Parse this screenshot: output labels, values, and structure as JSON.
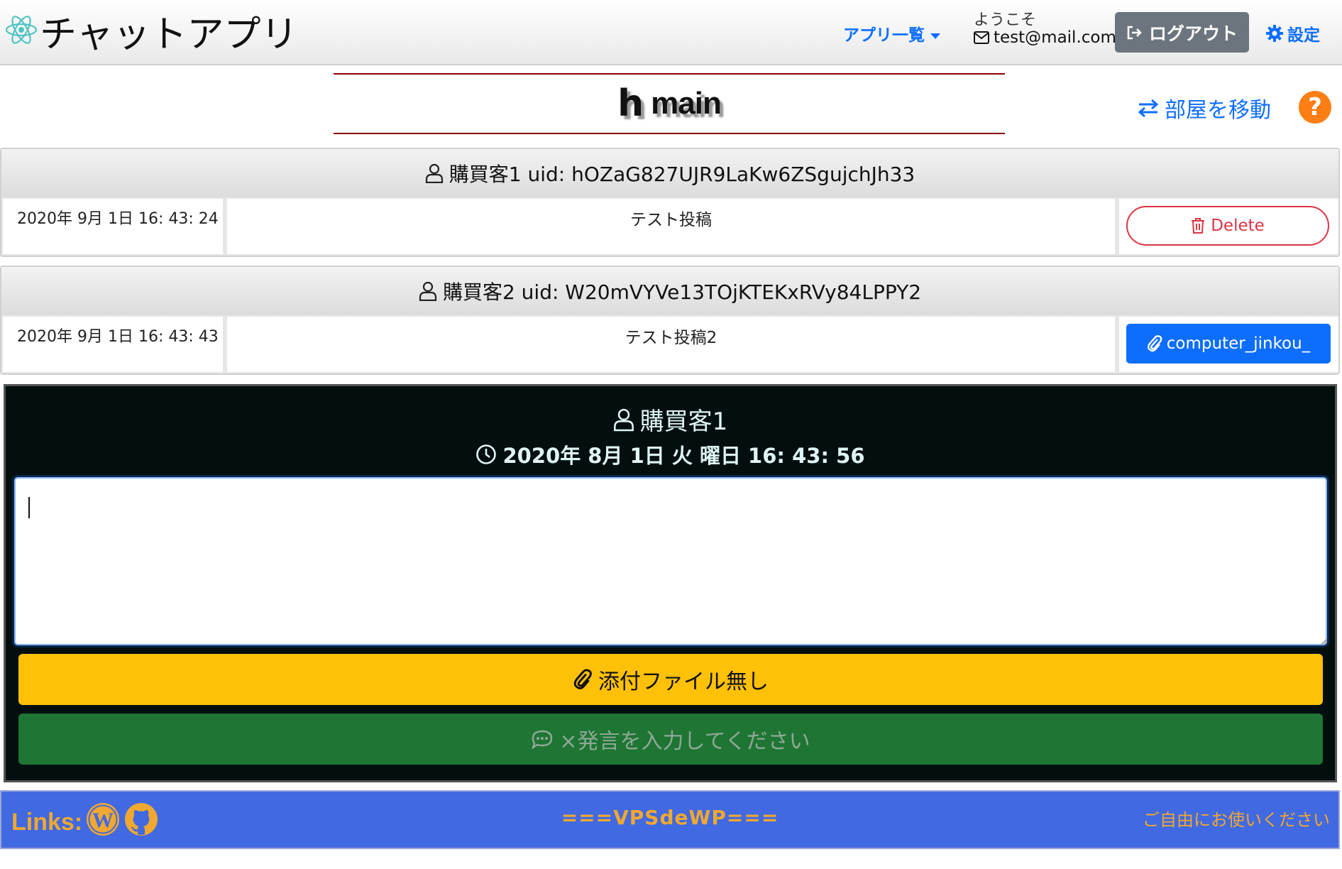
{
  "header": {
    "brand": "チャットアプリ",
    "apps_menu": "アプリ一覧",
    "welcome": "ようこそ",
    "email": "test@mail.com",
    "logout": "ログアウト",
    "settings": "設定"
  },
  "room": {
    "icon_letter": "h",
    "name": "main",
    "move_room": "部屋を移動",
    "help": "?"
  },
  "messages": [
    {
      "header": "購買客1 uid: hOZaG827UJR9LaKw6ZSgujchJh33",
      "time": "2020年 9月 1日 16: 43: 24",
      "text": "テスト投稿",
      "action_label": "Delete",
      "action_type": "delete"
    },
    {
      "header": "購買客2 uid: W20mVYVe13TOjKTEKxRVy84LPPY2",
      "time": "2020年 9月 1日 16: 43: 43",
      "text": "テスト投稿2",
      "action_label": "computer_jinkou_",
      "action_type": "attachment"
    }
  ],
  "compose": {
    "user": "購買客1",
    "datetime": "2020年 8月 1日 火 曜日 16: 43: 56",
    "textarea_value": "",
    "attach_label": "添付ファイル無し",
    "send_label": "×発言を入力してください"
  },
  "footer": {
    "links_label": "Links:",
    "center": "===VPSdeWP===",
    "right": "ご自由にお使いください"
  },
  "colors": {
    "primary": "#0d6efd",
    "danger": "#dc3545",
    "warning": "#ffc107",
    "success": "#1e7534",
    "secondary": "#6c757d",
    "footer_bg": "#4169e1",
    "footer_text": "#f0a830",
    "compose_bg": "#030f0f"
  },
  "icons": {
    "brand": "react-atom-icon",
    "email": "envelope-icon",
    "logout": "sign-out-icon",
    "settings": "gear-icon",
    "move_room": "exchange-arrows-icon",
    "help": "question-circle-icon",
    "user": "user-icon",
    "delete": "trash-icon",
    "attachment": "paperclip-icon",
    "clock": "clock-icon",
    "send": "comment-dots-icon",
    "wordpress": "wordpress-icon",
    "github": "github-icon"
  }
}
